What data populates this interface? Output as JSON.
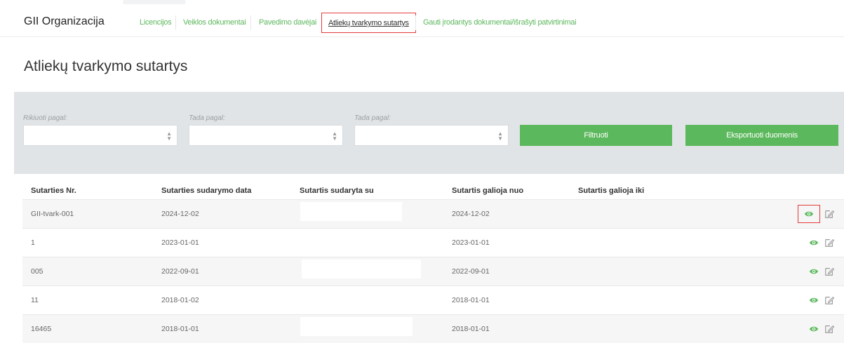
{
  "nav": {
    "brand": "GII Organizacija",
    "links": [
      {
        "label": "Licencijos"
      },
      {
        "label": "Veiklos dokumentai"
      },
      {
        "label": "Pavedimo davėjai"
      },
      {
        "label": "Atliekų tvarkymo sutartys",
        "active": true
      },
      {
        "label": "Gauti įrodantys dokumentai/išrašyti patvirtinimai"
      }
    ]
  },
  "page": {
    "title": "Atliekų tvarkymo sutartys"
  },
  "filters": {
    "sort1_label": "Rikiuoti pagal:",
    "sort2_label": "Tada pagal:",
    "sort3_label": "Tada pagal:",
    "filter_button": "Filtruoti",
    "export_button": "Eksportuoti duomenis"
  },
  "table": {
    "columns": [
      "Sutarties Nr.",
      "Sutarties sudarymo data",
      "Sutartis sudaryta su",
      "Sutartis galioja nuo",
      "Sutartis galioja iki"
    ],
    "rows": [
      {
        "nr": "GII-tvark-001",
        "date": "2024-12-02",
        "with": "",
        "from": "2024-12-02",
        "to": ""
      },
      {
        "nr": "1",
        "date": "2023-01-01",
        "with": "",
        "from": "2023-01-01",
        "to": ""
      },
      {
        "nr": "005",
        "date": "2022-09-01",
        "with": "",
        "from": "2022-09-01",
        "to": ""
      },
      {
        "nr": "11",
        "date": "2018-01-02",
        "with": "",
        "from": "2018-01-01",
        "to": ""
      },
      {
        "nr": "16465",
        "date": "2018-01-01",
        "with": "",
        "from": "2018-01-01",
        "to": ""
      }
    ]
  },
  "icons": {
    "view": "eye-icon",
    "edit": "edit-icon"
  },
  "colors": {
    "accent": "#5cb85c",
    "highlight": "#e23b3b",
    "panel": "#e1e4e6"
  }
}
